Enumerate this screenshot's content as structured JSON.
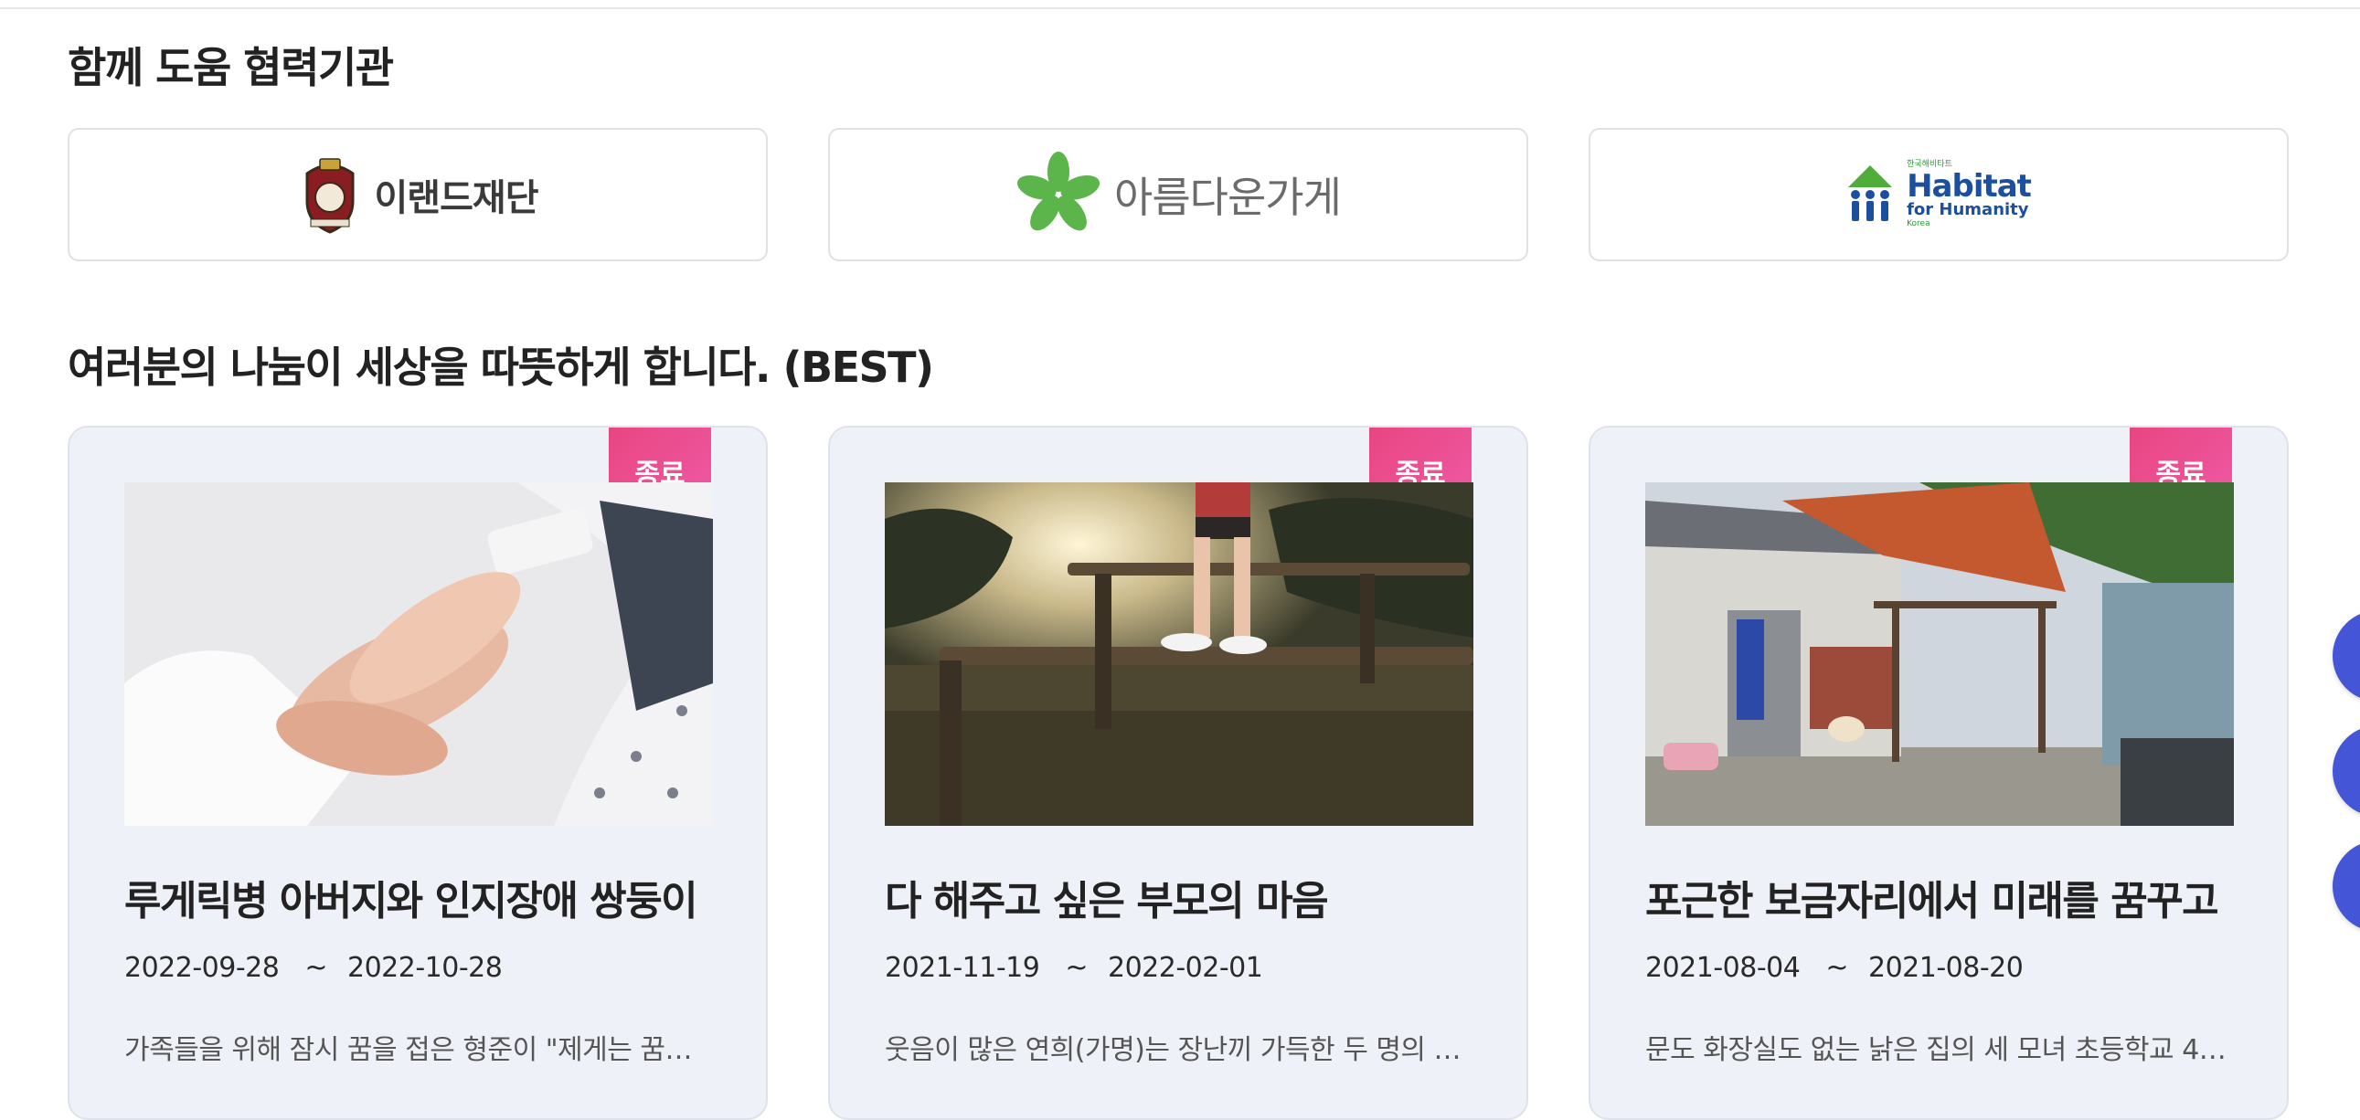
{
  "partners_section": {
    "title": "함께 도움 협력기관",
    "partners": [
      {
        "name": "이랜드재단",
        "logo_icon": "eland-crest-icon"
      },
      {
        "name": "아름다운가게",
        "logo_icon": "green-leaf-icon"
      },
      {
        "name_kr": "한국해비타트",
        "name_en_1": "Habitat",
        "name_en_2": "for Humanity",
        "name_en_3": "Korea",
        "logo_icon": "habitat-house-icon"
      }
    ]
  },
  "best_section": {
    "title": "여러분의 나눔이 세상을 따뜻하게 합니다. (BEST)",
    "campaigns": [
      {
        "status": "종료",
        "title": "루게릭병 아버지와 인지장애 쌍둥이",
        "start_date": "2022-09-28",
        "separator": "~",
        "end_date": "2022-10-28",
        "description": "가족들을 위해 잠시 꿈을 접은 형준이 \"제게는 꿈…",
        "image": "holding-hands-hospital-image"
      },
      {
        "status": "종료",
        "title": "다 해주고 싶은 부모의 마음",
        "start_date": "2021-11-19",
        "separator": "~",
        "end_date": "2022-02-01",
        "description": "웃음이 많은 연희(가명)는 장난끼 가득한 두 명의 …",
        "image": "child-balance-beam-image"
      },
      {
        "status": "종료",
        "title": "포근한 보금자리에서 미래를 꿈꾸고",
        "start_date": "2021-08-04",
        "separator": "~",
        "end_date": "2021-08-20",
        "description": "문도 화장실도 없는 낡은 집의 세 모녀 초등학교 4…",
        "image": "old-house-image"
      }
    ]
  },
  "colors": {
    "badge": "#e8457f",
    "card_bg": "#eef1f8",
    "float_button": "#4455d8"
  }
}
